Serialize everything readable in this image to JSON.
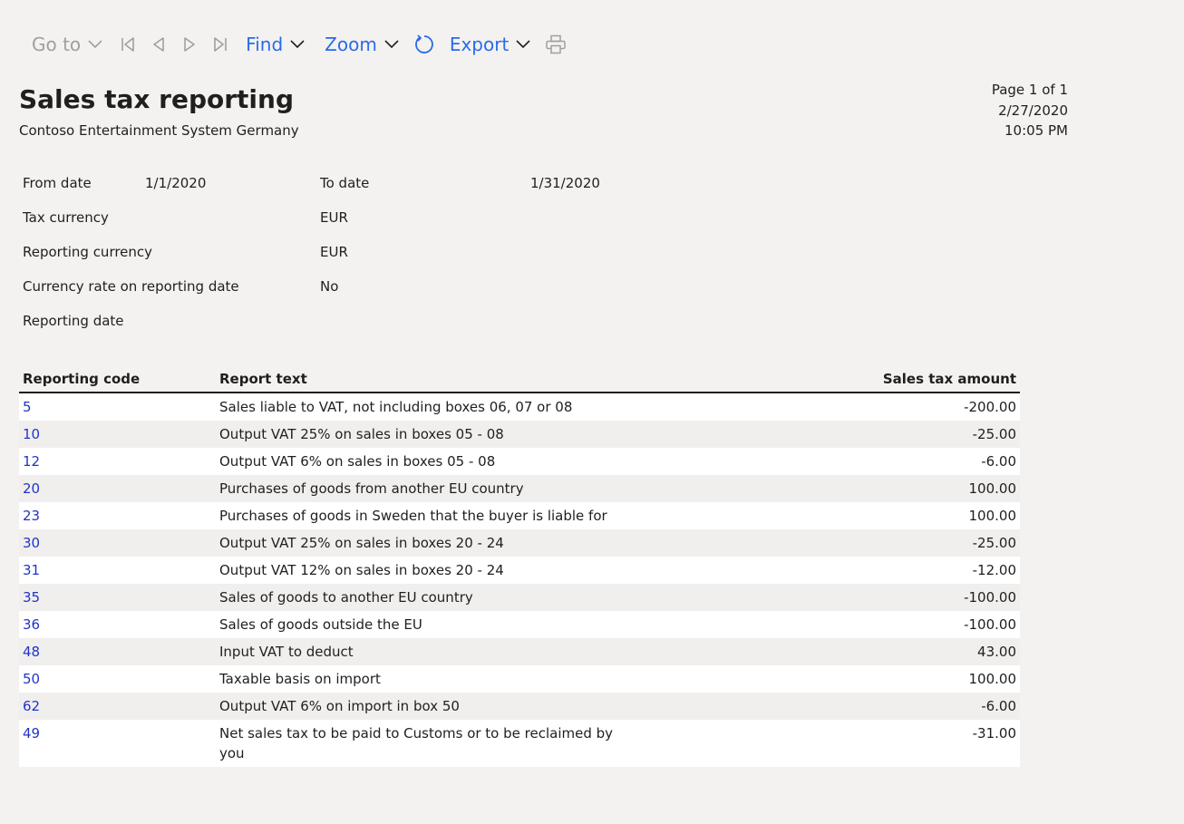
{
  "toolbar": {
    "goto_label": "Go to",
    "find_label": "Find",
    "zoom_label": "Zoom",
    "export_label": "Export",
    "icons": [
      "first-page-icon",
      "previous-page-icon",
      "next-page-icon",
      "last-page-icon",
      "refresh-icon",
      "print-icon"
    ],
    "colors": {
      "active": "#2b6be6",
      "disabled": "#a19f9d"
    }
  },
  "report": {
    "title": "Sales tax reporting",
    "company": "Contoso Entertainment System Germany",
    "page": "Page 1 of 1",
    "date": "2/27/2020",
    "time": "10:05 PM"
  },
  "params": {
    "from_date_label": "From date",
    "from_date_value": "1/1/2020",
    "to_date_label": "To date",
    "to_date_value": "1/31/2020",
    "tax_currency_label": "Tax currency",
    "tax_currency_value": "EUR",
    "reporting_currency_label": "Reporting currency",
    "reporting_currency_value": "EUR",
    "currency_rate_label": "Currency rate on reporting date",
    "currency_rate_value": "No",
    "reporting_date_label": "Reporting date"
  },
  "table": {
    "headers": [
      "Reporting code",
      "Report text",
      "Sales tax amount"
    ],
    "rows": [
      {
        "code": "5",
        "text": "Sales liable to VAT, not including boxes 06, 07 or 08",
        "amount": "-200.00"
      },
      {
        "code": "10",
        "text": "Output VAT 25% on sales in boxes 05 - 08",
        "amount": "-25.00"
      },
      {
        "code": "12",
        "text": "Output VAT 6% on sales in boxes 05 - 08",
        "amount": "-6.00"
      },
      {
        "code": "20",
        "text": "Purchases of goods from another EU country",
        "amount": "100.00"
      },
      {
        "code": "23",
        "text": "Purchases of goods in Sweden that the buyer is liable for",
        "amount": "100.00"
      },
      {
        "code": "30",
        "text": "Output VAT 25% on sales in boxes 20 - 24",
        "amount": "-25.00"
      },
      {
        "code": "31",
        "text": "Output VAT 12% on sales in boxes 20 - 24",
        "amount": "-12.00"
      },
      {
        "code": "35",
        "text": "Sales of goods to another EU country",
        "amount": "-100.00"
      },
      {
        "code": "36",
        "text": "Sales of goods outside the EU",
        "amount": "-100.00"
      },
      {
        "code": "48",
        "text": "Input VAT to deduct",
        "amount": "43.00"
      },
      {
        "code": "50",
        "text": "Taxable basis on import",
        "amount": "100.00"
      },
      {
        "code": "62",
        "text": "Output VAT 6% on import in box 50",
        "amount": "-6.00"
      },
      {
        "code": "49",
        "text": "Net sales tax to be paid to Customs or to be reclaimed by you",
        "amount": "-31.00"
      }
    ]
  }
}
